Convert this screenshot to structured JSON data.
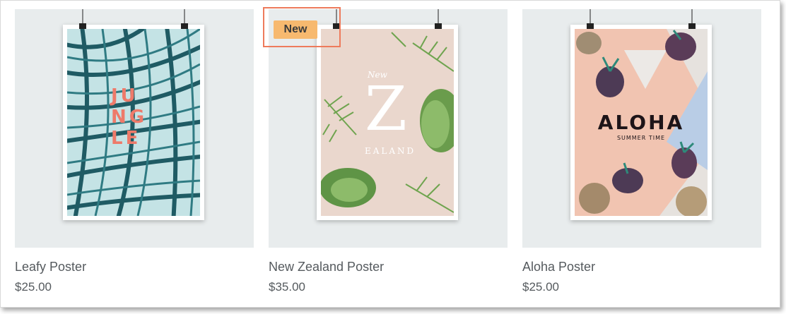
{
  "badge": {
    "label": "New",
    "accent": "#f7b96f",
    "highlight": "#ee7b5c"
  },
  "products": [
    {
      "name": "Leafy Poster",
      "price": "$25.00",
      "image": "jungle-poster",
      "art": {
        "lines": [
          "JU",
          "NG",
          "LE"
        ]
      }
    },
    {
      "name": "New Zealand Poster",
      "price": "$35.00",
      "image": "new-zealand-poster",
      "art": {
        "small": "New",
        "big": "Z",
        "rest": "EALAND"
      }
    },
    {
      "name": "Aloha Poster",
      "price": "$25.00",
      "image": "aloha-poster",
      "art": {
        "title": "ALOHA",
        "subtitle": "SUMMER TIME"
      }
    }
  ],
  "colors": {
    "card_bg": "#e8eced",
    "text": "#555a5e",
    "jungle_leaf": "#1f5b64",
    "nz_bg": "#ead7cd",
    "aloha_peach": "#f1c4b1",
    "aloha_blue": "#b9cde6"
  }
}
